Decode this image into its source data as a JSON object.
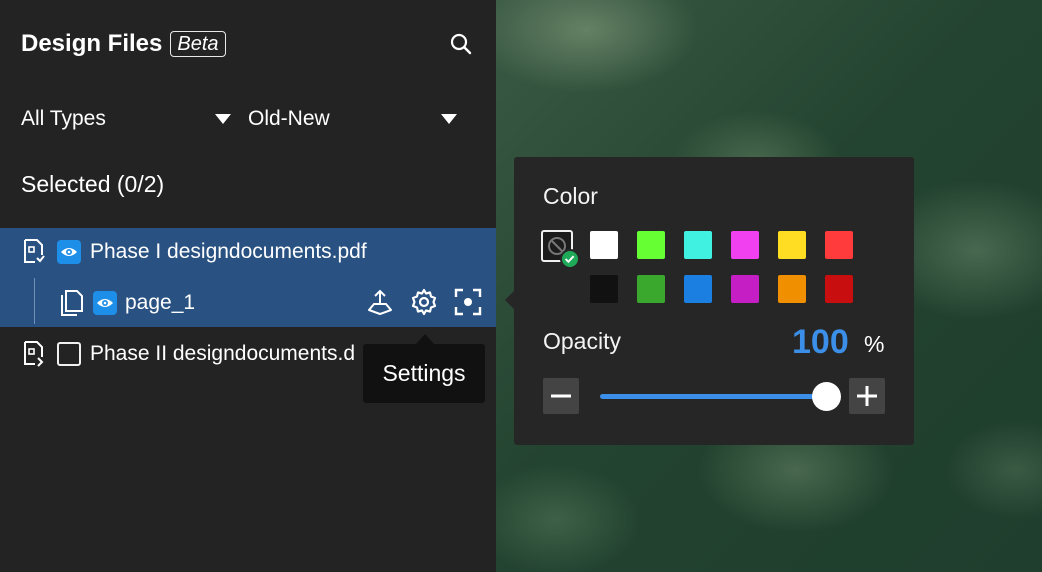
{
  "header": {
    "title": "Design Files",
    "badge": "Beta",
    "search_icon": "search-icon"
  },
  "filters": {
    "type": {
      "value": "All Types"
    },
    "sort": {
      "value": "Old-New"
    }
  },
  "selection": {
    "label": "Selected (0/2)"
  },
  "files": [
    {
      "name": "Phase I designdocuments.pdf",
      "visible": true,
      "expanded": true,
      "pages": [
        {
          "name": "page_1",
          "visible": true
        }
      ]
    },
    {
      "name": "Phase II designdocuments.d",
      "visible": false
    }
  ],
  "tooltip": {
    "text": "Settings"
  },
  "color_popover": {
    "color_label": "Color",
    "swatches_row1": [
      "#ffffff",
      "#66ff33",
      "#40f0e0",
      "#f040f0",
      "#ffdd22",
      "#ff3b3b"
    ],
    "swatches_row2": [
      "#111111",
      "#3aa82c",
      "#1a7fe0",
      "#c41ec4",
      "#f09000",
      "#c80e0e"
    ],
    "selected": "none",
    "opacity_label": "Opacity",
    "opacity_value": "100",
    "opacity_unit": "%",
    "opacity_level": 1.0
  },
  "colors": {
    "panel_bg": "#232323",
    "selected_row": "#295282",
    "accent": "#3b8fe8",
    "check": "#1faa59"
  }
}
